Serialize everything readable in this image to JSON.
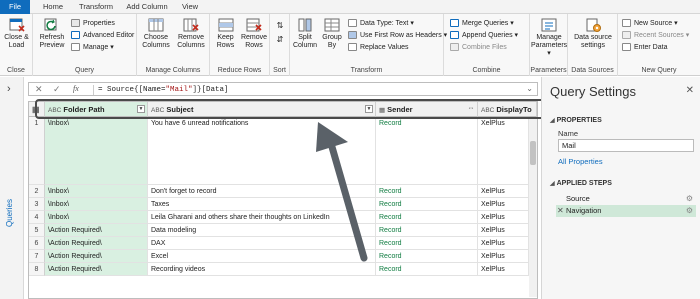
{
  "tabs": [
    "File",
    "Home",
    "Transform",
    "Add Column",
    "View"
  ],
  "ribbon": {
    "close": {
      "close_load": "Close &",
      "close_load2": "Load",
      "label": "Close"
    },
    "query": {
      "refresh": "Refresh",
      "preview": "Preview",
      "properties": "Properties",
      "advanced_editor": "Advanced Editor",
      "manage": "Manage",
      "label": "Query"
    },
    "manage_columns": {
      "choose": "Choose",
      "columns": "Columns",
      "remove": "Remove",
      "columns2": "Columns",
      "label": "Manage Columns"
    },
    "reduce_rows": {
      "keep": "Keep",
      "rows": "Rows",
      "remove": "Remove",
      "rows2": "Rows",
      "label": "Reduce Rows"
    },
    "sort": {
      "label": "Sort"
    },
    "transform": {
      "split": "Split",
      "column": "Column",
      "group": "Group",
      "by": "By",
      "data_type": "Data Type: Text",
      "use_first_row": "Use First Row as Headers",
      "replace_values": "Replace Values",
      "label": "Transform"
    },
    "combine": {
      "merge": "Merge Queries",
      "append": "Append Queries",
      "combine_files": "Combine Files",
      "label": "Combine"
    },
    "parameters": {
      "manage": "Manage",
      "parameters": "Parameters",
      "label": "Parameters"
    },
    "data_sources": {
      "data_source": "Data source",
      "settings": "settings",
      "label": "Data Sources"
    },
    "new_query": {
      "new_source": "New Source",
      "recent_sources": "Recent Sources",
      "enter_data": "Enter Data",
      "label": "New Query"
    }
  },
  "queries_pane": {
    "label": "Queries",
    "expand": "›"
  },
  "formula_bar": {
    "cancel": "✕",
    "commit": "✓",
    "fx": "fx",
    "prefix": "= Source{[Name=",
    "string": "\"Mail\"",
    "suffix": "]}[Data]",
    "chevron": "⌄"
  },
  "grid": {
    "columns": [
      {
        "type": "ABC",
        "name": "Folder Path"
      },
      {
        "type": "ABC",
        "name": "Subject"
      },
      {
        "type": "▦",
        "name": "Sender"
      },
      {
        "type": "ABC",
        "name": "DisplayTo"
      }
    ],
    "rows": [
      {
        "n": "1",
        "folder": "\\Inbox\\",
        "subject": "You have 6 unread notifications",
        "sender": "Record",
        "display": "XelPlus"
      },
      {
        "n": "2",
        "folder": "\\Inbox\\",
        "subject": "Don't forget to record",
        "sender": "Record",
        "display": "XelPlus"
      },
      {
        "n": "3",
        "folder": "\\Inbox\\",
        "subject": "Taxes",
        "sender": "Record",
        "display": "XelPlus"
      },
      {
        "n": "4",
        "folder": "\\Inbox\\",
        "subject": "Leila Gharani and others share their thoughts on LinkedIn",
        "sender": "Record",
        "display": "XelPlus"
      },
      {
        "n": "5",
        "folder": "\\Action Required\\",
        "subject": "Data modeling",
        "sender": "Record",
        "display": "XelPlus"
      },
      {
        "n": "6",
        "folder": "\\Action Required\\",
        "subject": "DAX",
        "sender": "Record",
        "display": "XelPlus"
      },
      {
        "n": "7",
        "folder": "\\Action Required\\",
        "subject": "Excel",
        "sender": "Record",
        "display": "XelPlus"
      },
      {
        "n": "8",
        "folder": "\\Action Required\\",
        "subject": "Recording videos",
        "sender": "Record",
        "display": "XelPlus"
      }
    ]
  },
  "query_settings": {
    "title": "Query Settings",
    "close": "✕",
    "properties_header": "PROPERTIES",
    "name_label": "Name",
    "name_value": "Mail",
    "all_properties": "All Properties",
    "applied_steps_header": "APPLIED STEPS",
    "steps": [
      {
        "name": "Source",
        "active": false
      },
      {
        "name": "Navigation",
        "active": true
      }
    ]
  },
  "colors": {
    "accent": "#0f6cbd",
    "record_green": "#107c41",
    "selected_step": "#cfe8d8",
    "selected_col": "#d9f0e1"
  }
}
